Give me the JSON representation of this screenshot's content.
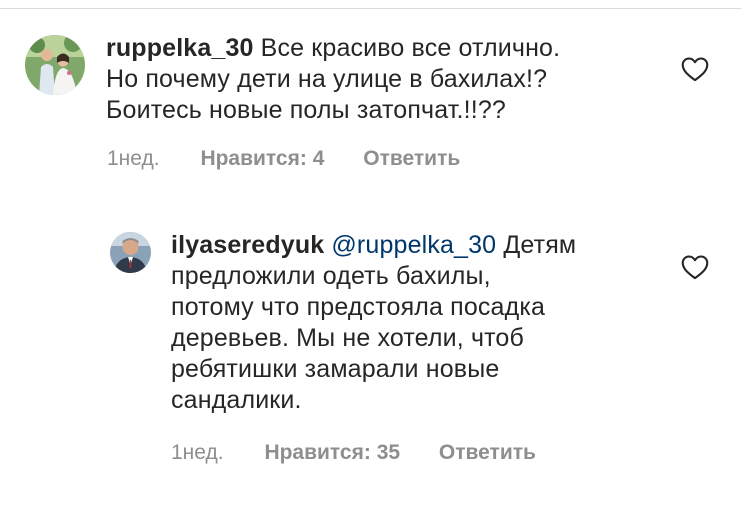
{
  "comment1": {
    "username": "ruppelka_30",
    "lines": [
      "Все красиво все отлично.",
      "Но почему дети на улице в бахилах!?",
      "Боитесь новые полы затопчат.!!??"
    ],
    "age": "1нед.",
    "likes_label": "Нравится: 4",
    "reply_label": "Ответить",
    "avatar_icon": "avatar-photo-couple",
    "like_icon": "heart-outline-icon"
  },
  "comment2": {
    "username": "ilyaseredyuk",
    "mention": "@ruppelka_30",
    "first_line_rest": "Детям",
    "lines": [
      "предложили одеть бахилы,",
      "потому что предстояла посадка",
      "деревьев. Мы не хотели, чтоб",
      "ребятишки замарали новые",
      "сандалики."
    ],
    "age": "1нед.",
    "likes_label": "Нравится: 35",
    "reply_label": "Ответить",
    "avatar_icon": "avatar-photo-man",
    "like_icon": "heart-outline-icon"
  },
  "colors": {
    "text": "#262626",
    "secondary": "#8e8e8e",
    "mention": "#00376b",
    "divider": "#dbdbdb"
  }
}
